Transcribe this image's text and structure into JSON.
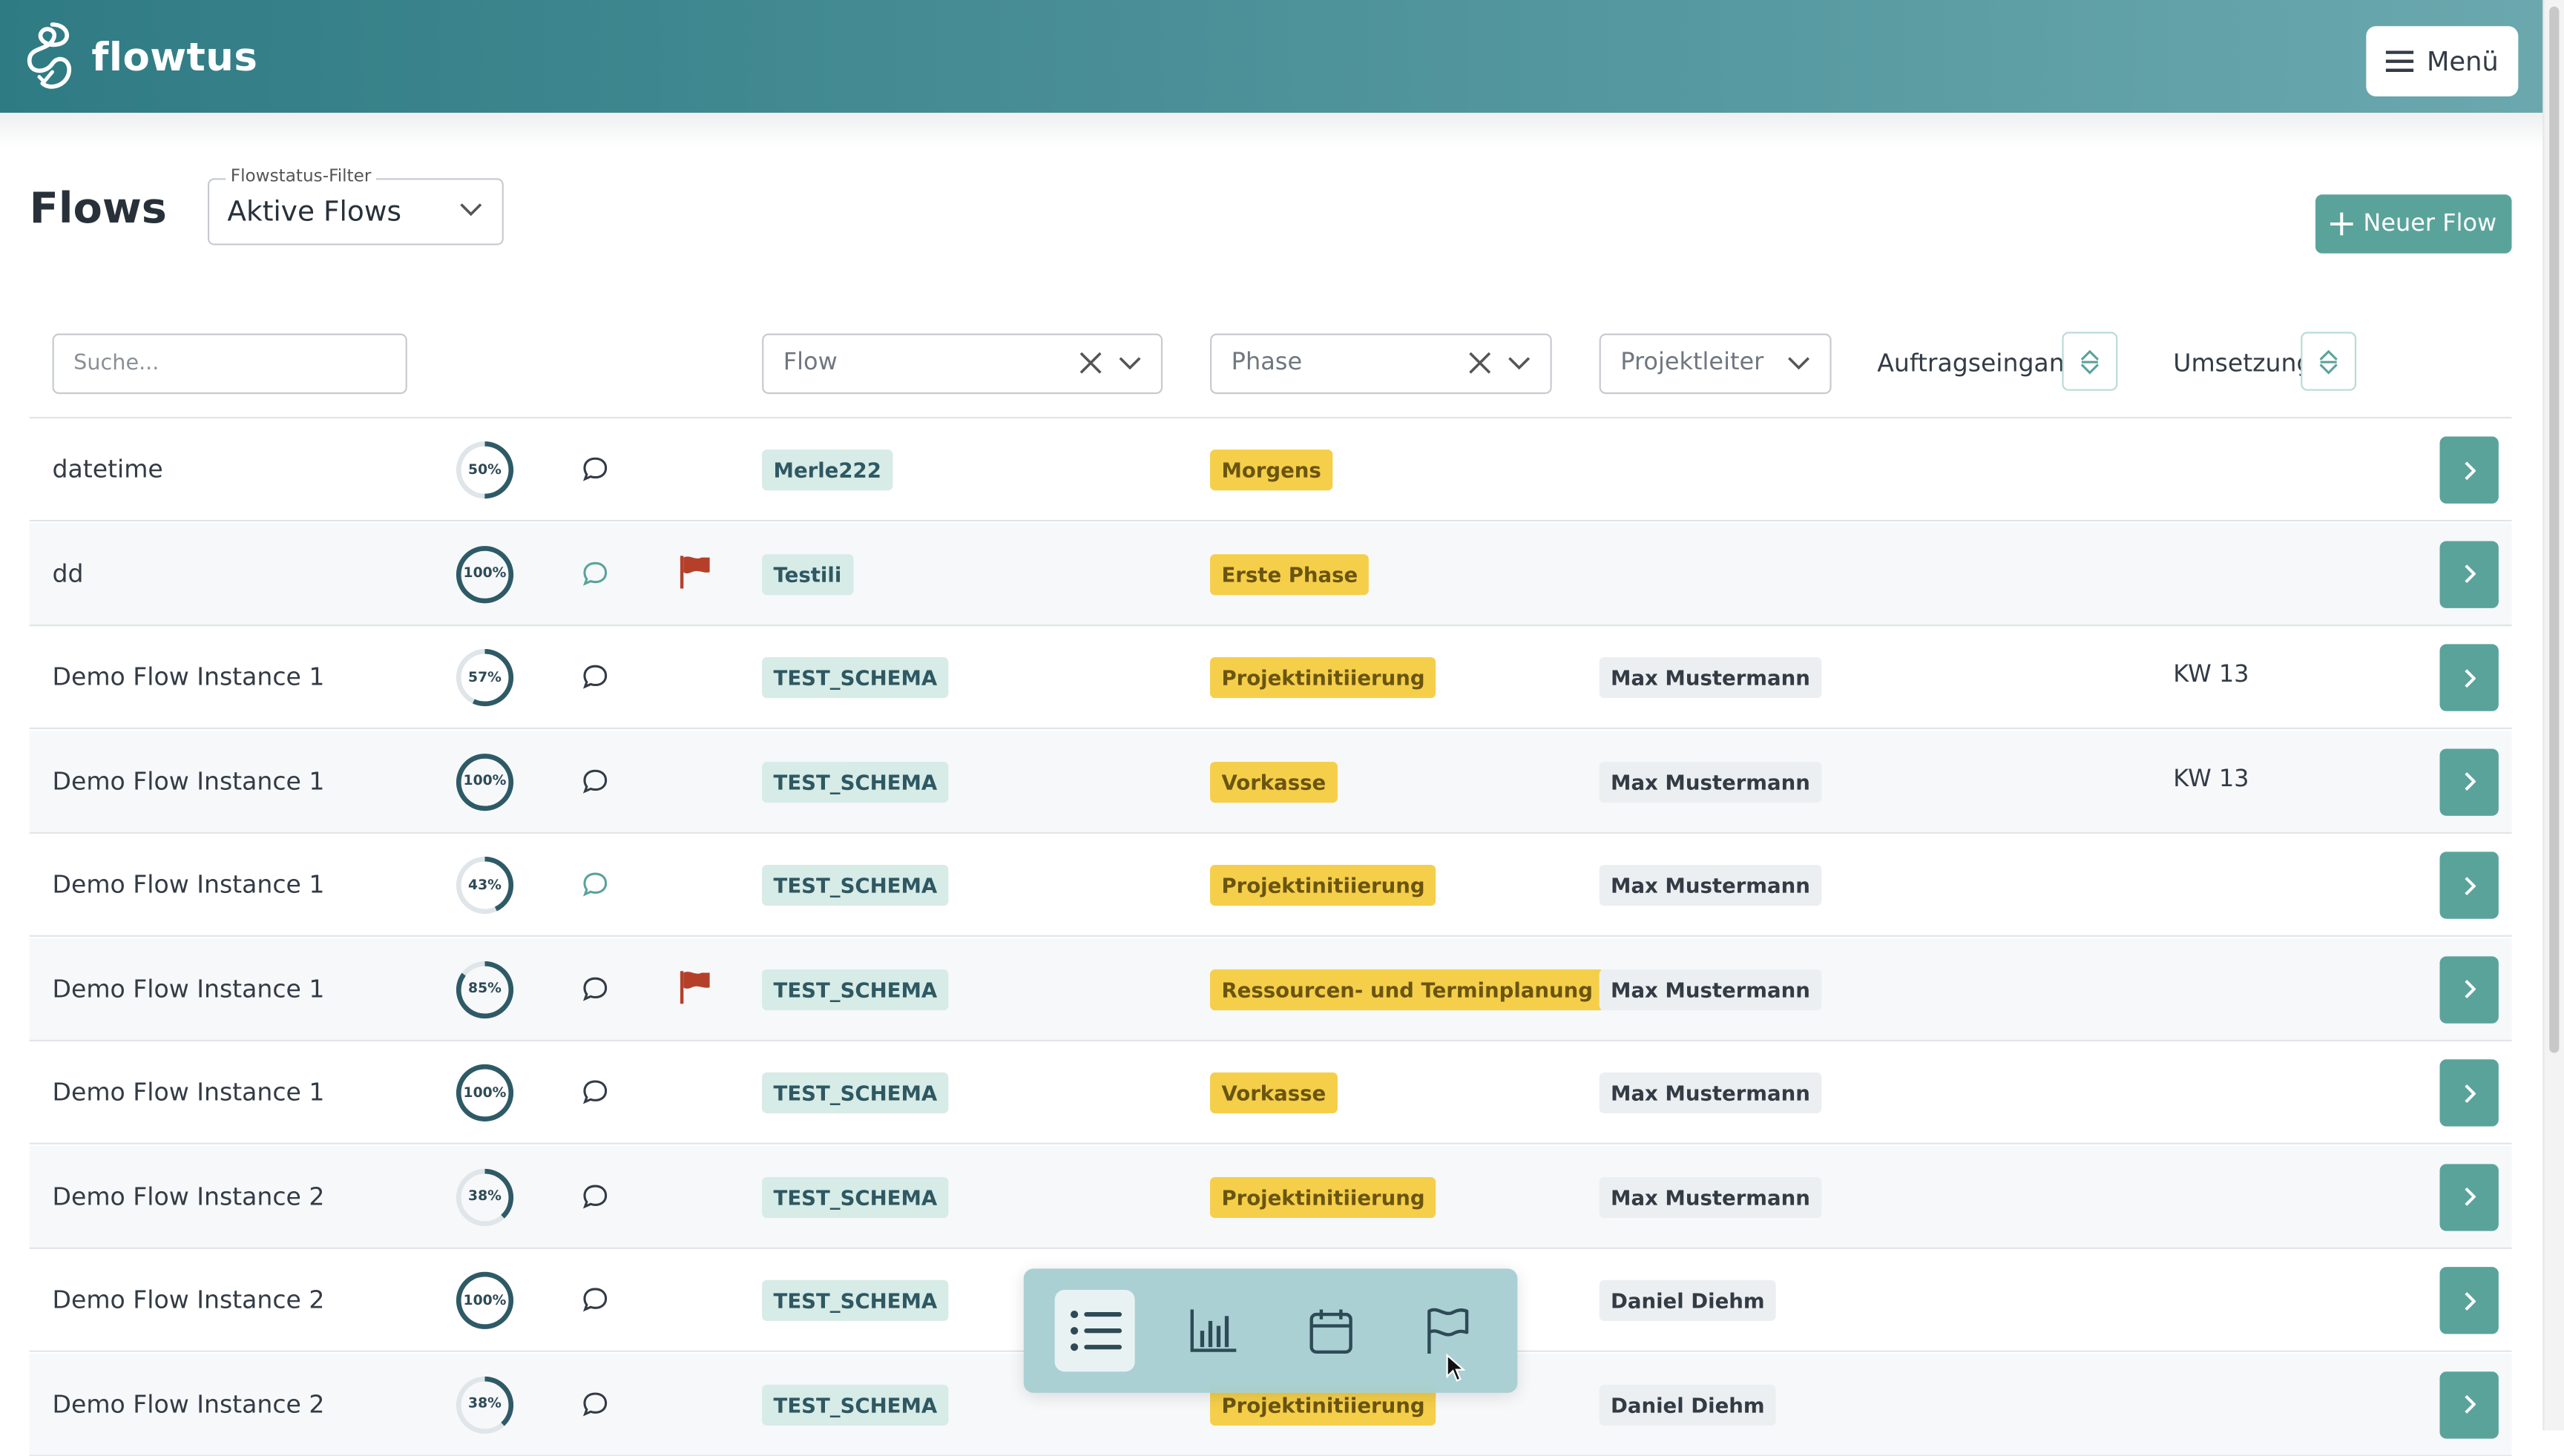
{
  "app": {
    "name": "flowtus",
    "menu_label": "Menü"
  },
  "page": {
    "title": "Flows",
    "status_filter": {
      "legend": "Flowstatus-Filter",
      "value": "Aktive Flows"
    },
    "new_flow_label": "Neuer Flow"
  },
  "filters": {
    "search_placeholder": "Suche...",
    "flow_placeholder": "Flow",
    "phase_placeholder": "Phase",
    "lead_placeholder": "Projektleiter",
    "order_intake_label": "Auftragseingang",
    "implementation_label": "Umsetzung"
  },
  "rows": [
    {
      "name": "datetime",
      "progress": "50%",
      "flagged": false,
      "flow": "Merle222",
      "phase": "Morgens",
      "lead": "",
      "kw": ""
    },
    {
      "name": "dd",
      "progress": "100%",
      "flagged": true,
      "flow": "Testili",
      "phase": "Erste Phase",
      "lead": "",
      "kw": ""
    },
    {
      "name": "Demo Flow Instance 1",
      "progress": "57%",
      "flagged": false,
      "flow": "TEST_SCHEMA",
      "phase": "Projektinitiierung",
      "lead": "Max Mustermann",
      "kw": "KW 13"
    },
    {
      "name": "Demo Flow Instance 1",
      "progress": "100%",
      "flagged": false,
      "flow": "TEST_SCHEMA",
      "phase": "Vorkasse",
      "lead": "Max Mustermann",
      "kw": "KW 13"
    },
    {
      "name": "Demo Flow Instance 1",
      "progress": "43%",
      "flagged": false,
      "flow": "TEST_SCHEMA",
      "phase": "Projektinitiierung",
      "lead": "Max Mustermann",
      "kw": ""
    },
    {
      "name": "Demo Flow Instance 1",
      "progress": "85%",
      "flagged": true,
      "flow": "TEST_SCHEMA",
      "phase": "Ressourcen- und Terminplanung",
      "lead": "Max Mustermann",
      "kw": ""
    },
    {
      "name": "Demo Flow Instance 1",
      "progress": "100%",
      "flagged": false,
      "flow": "TEST_SCHEMA",
      "phase": "Vorkasse",
      "lead": "Max Mustermann",
      "kw": ""
    },
    {
      "name": "Demo Flow Instance 2",
      "progress": "38%",
      "flagged": false,
      "flow": "TEST_SCHEMA",
      "phase": "Projektinitiierung",
      "lead": "Max Mustermann",
      "kw": ""
    },
    {
      "name": "Demo Flow Instance 2",
      "progress": "100%",
      "flagged": false,
      "flow": "TEST_SCHEMA",
      "phase": "",
      "lead": "Daniel Diehm",
      "kw": ""
    },
    {
      "name": "Demo Flow Instance 2",
      "progress": "38%",
      "flagged": false,
      "flow": "TEST_SCHEMA",
      "phase": "Projektinitiierung",
      "lead": "Daniel Diehm",
      "kw": ""
    }
  ],
  "bottom_nav": [
    "list-icon",
    "bar-chart-icon",
    "calendar-icon",
    "flag-icon"
  ],
  "colors": {
    "header": "#3f8a92",
    "accent": "#5aa39b",
    "phase": "#f5cf4a",
    "flow_tag": "#d7ebe7",
    "flag": "#b5402a"
  }
}
